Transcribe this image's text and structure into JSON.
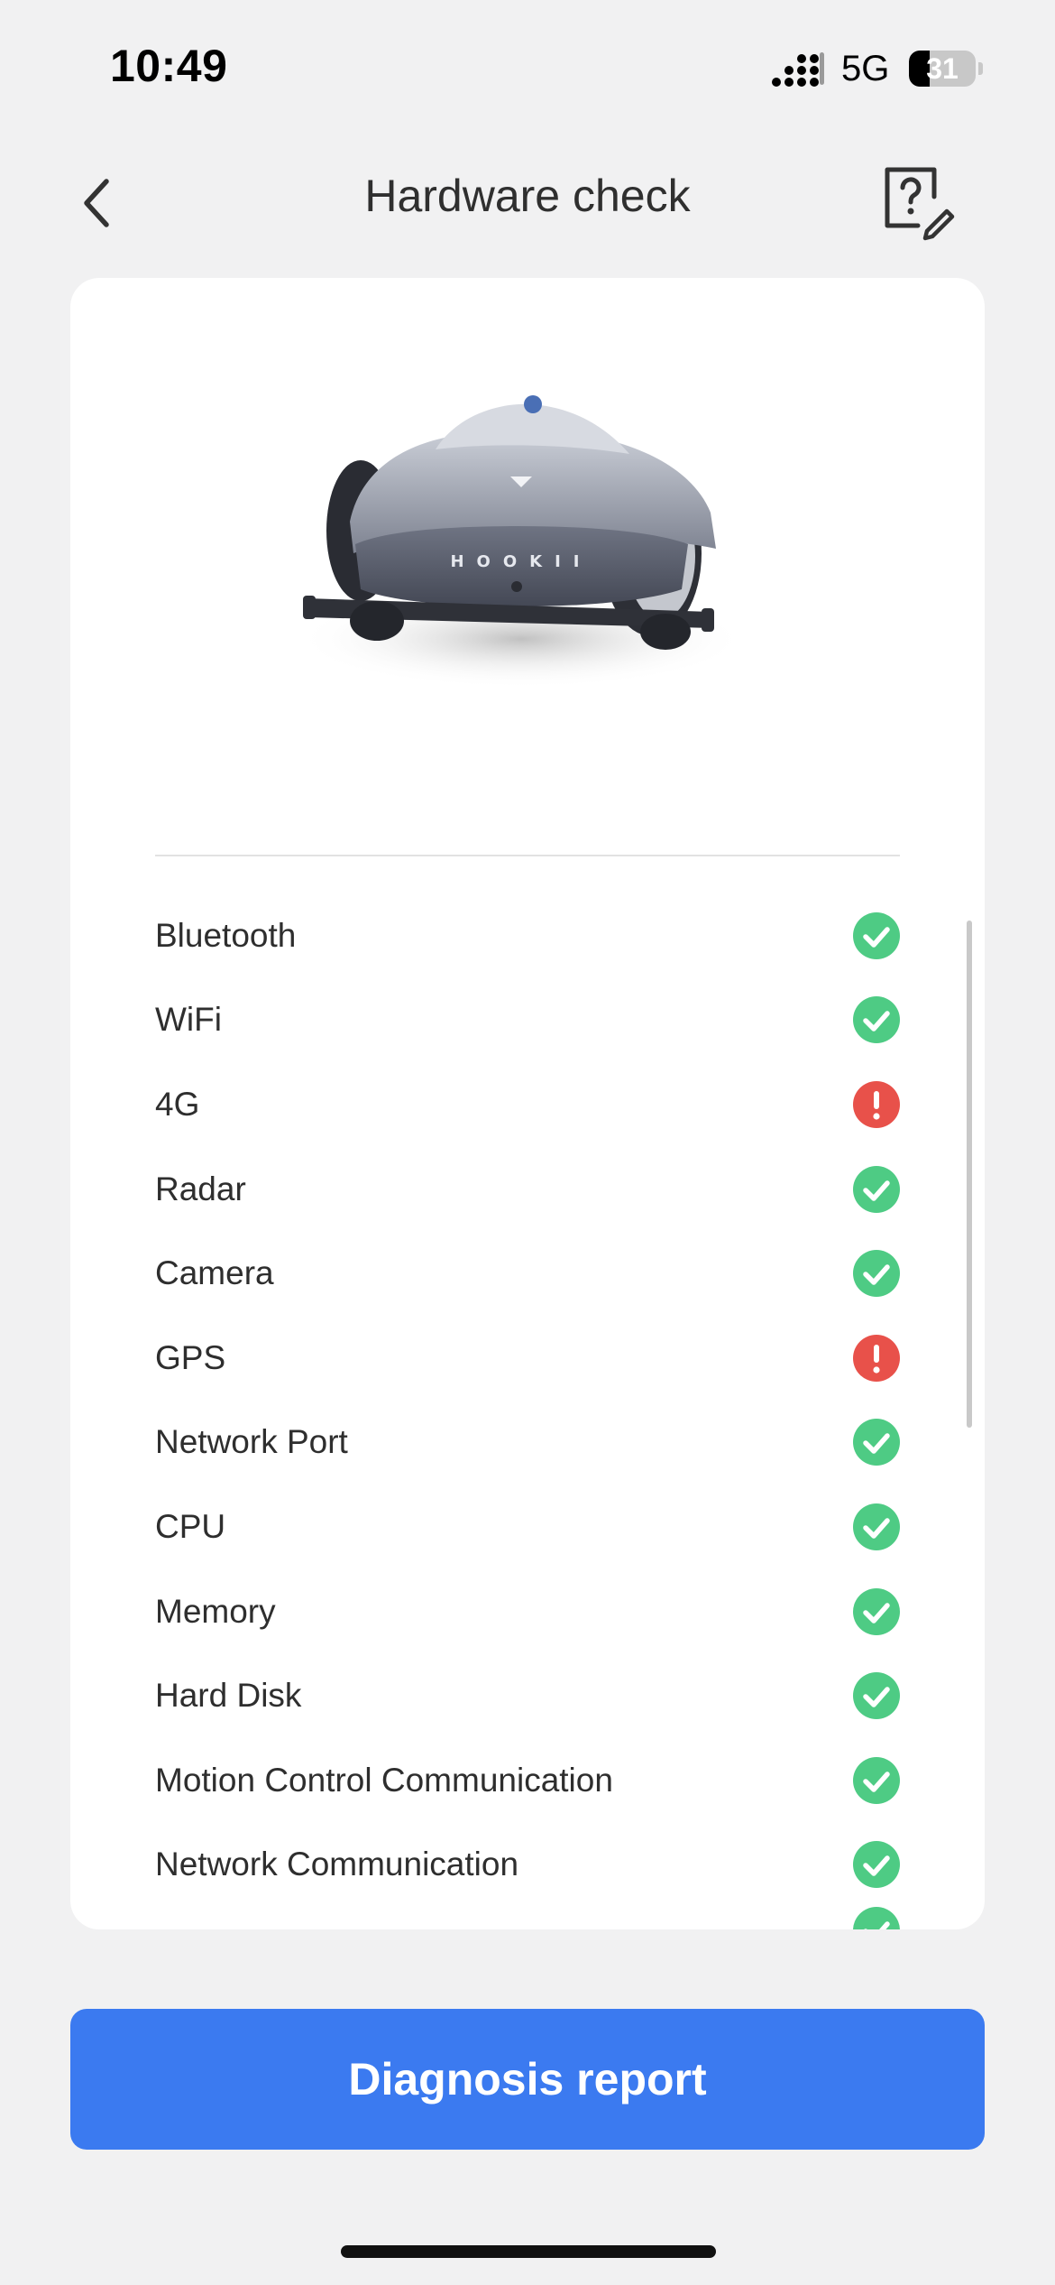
{
  "status_bar": {
    "time": "10:49",
    "network": "5G",
    "battery_percent": "31",
    "battery_level": 0.31
  },
  "header": {
    "title": "Hardware check",
    "back_icon": "chevron-left-icon",
    "help_icon": "help-feedback-icon"
  },
  "device": {
    "brand_text": "HOOKII"
  },
  "checks": [
    {
      "label": "Bluetooth",
      "status": "ok"
    },
    {
      "label": "WiFi",
      "status": "ok"
    },
    {
      "label": "4G",
      "status": "error"
    },
    {
      "label": "Radar",
      "status": "ok"
    },
    {
      "label": "Camera",
      "status": "ok"
    },
    {
      "label": "GPS",
      "status": "error"
    },
    {
      "label": "Network Port",
      "status": "ok"
    },
    {
      "label": "CPU",
      "status": "ok"
    },
    {
      "label": "Memory",
      "status": "ok"
    },
    {
      "label": "Hard Disk",
      "status": "ok"
    },
    {
      "label": "Motion Control Communication",
      "status": "ok"
    },
    {
      "label": "Network Communication",
      "status": "ok"
    }
  ],
  "colors": {
    "ok": "#4ecb84",
    "error": "#e8514a",
    "primary": "#3b7af0"
  },
  "footer": {
    "primary_button_label": "Diagnosis report"
  }
}
